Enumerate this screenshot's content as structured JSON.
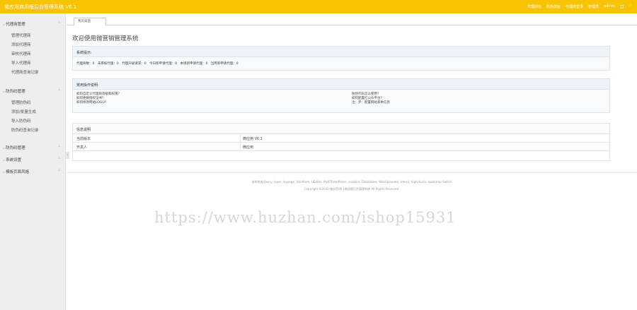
{
  "app": {
    "title": "微应用商用版后台管理系统 V6.1"
  },
  "topbar": {
    "links": [
      "代理前台",
      "防伪前台",
      "代理商登录",
      "管理员"
    ],
    "user": "admin",
    "icons": [
      "user-icon",
      "logout-icon"
    ]
  },
  "sidebar": {
    "groups": [
      {
        "label": "代理商管理",
        "items": [
          "管理代理商",
          "添加代理商",
          "审核代理商",
          "导入代理商",
          "代理商查询记录"
        ]
      },
      {
        "label": "防伪码管理",
        "items": [
          "管理防伪码",
          "添加/批量生成",
          "导入防伪码",
          "防伪码查询记录"
        ]
      },
      {
        "label": "防伪码管理"
      },
      {
        "label": "系统设置"
      },
      {
        "label": "模板页面风格"
      }
    ]
  },
  "tabs": [
    {
      "label": "我的桌面"
    }
  ],
  "main": {
    "welcome": "欢迎使用微营销管理系统",
    "stats_panel": {
      "title": "系统提示:",
      "text": "代理商数：0　未审核代理：0　代理升级请求：0　今日新申请代理：0　本周新申请代理：0　当月新申请代理：0"
    },
    "ops_panel": {
      "title": "常用操作说明:",
      "left": [
        "如何自定义代理商等级和权限？",
        "如何更换授权证书？",
        "如何修改网站LOGO？"
      ],
      "right": [
        "防伪代码怎么使用？",
        "如何配置红公众平台？",
        "注：步：配置网站基本信息"
      ]
    },
    "info_panel": {
      "title": "信息说明",
      "rows": [
        {
          "key": "当前版本",
          "value": "微应用 V6.1"
        },
        {
          "key": "开发人",
          "value": "微应用"
        }
      ]
    },
    "footer_line1": "该系统由jQuery, layer, laypage, Validform, UEditor, My97DatePicker, iconfont, Datatables, WebUploaded, icheck, highcharts, bootstrap-Switch",
    "footer_line2": "Copyright ©2020 微应用V6.1商用版后台管理系统 All Rights Reserved."
  },
  "watermark": "https://www.huzhan.com/ishop15931"
}
